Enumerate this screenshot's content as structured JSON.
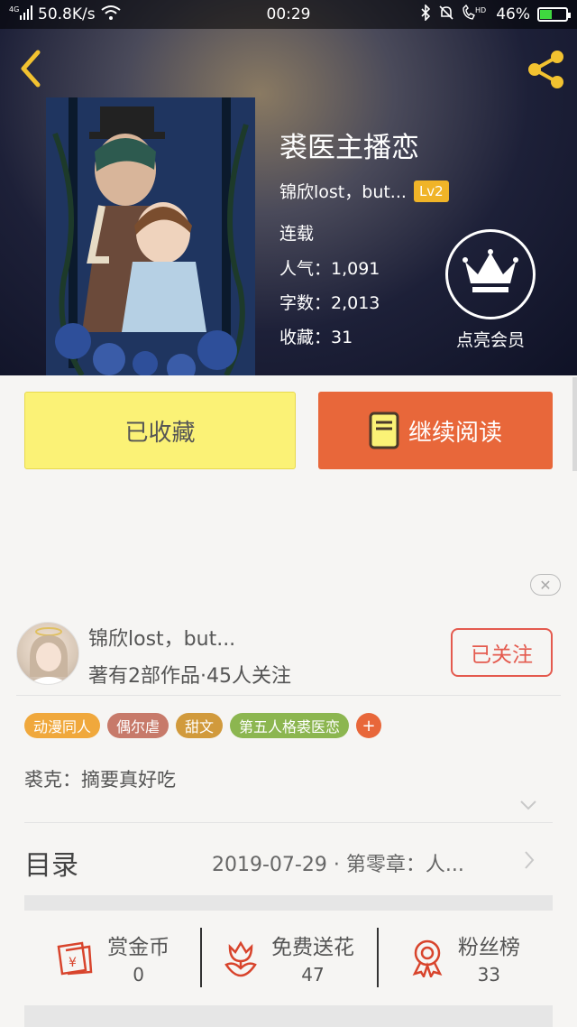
{
  "status_bar": {
    "network": "4G",
    "speed": "50.8K/s",
    "time": "00:29",
    "hd": "HD",
    "battery": "46%",
    "battery_level": 0.46
  },
  "book": {
    "title": "裘医主播恋",
    "author": "锦欣lost，but...",
    "level": "Lv2",
    "status": "连载",
    "popularity": "人气：1,091",
    "word_count": "字数：2,013",
    "favorites": "收藏：31"
  },
  "vip": {
    "label": "点亮会员"
  },
  "actions": {
    "collected_label": "已收藏",
    "continue_label": "继续阅读"
  },
  "author_card": {
    "name": "锦欣lost，but...",
    "stats": "著有2部作品·45人关注",
    "follow_label": "已关注"
  },
  "tags": [
    {
      "label": "动漫同人",
      "color": "#f0a83c"
    },
    {
      "label": "偶尔虐",
      "color": "#c77a6a"
    },
    {
      "label": "甜文",
      "color": "#d19a3c"
    },
    {
      "label": "第五人格裘医恋",
      "color": "#8cb650"
    }
  ],
  "tag_add": "+",
  "summary": "裘克：摘要真好吃",
  "toc": {
    "label": "目录",
    "latest": "2019-07-29 · 第零章：人..."
  },
  "stats": [
    {
      "label": "赏金币",
      "value": "0",
      "icon": "bounty-coin-icon"
    },
    {
      "label": "免费送花",
      "value": "47",
      "icon": "flower-icon"
    },
    {
      "label": "粉丝榜",
      "value": "33",
      "icon": "ribbon-badge-icon"
    }
  ],
  "colors": {
    "accent": "#e8673a",
    "collected_bg": "#fbf276",
    "follow": "#e45a4e",
    "badge": "#f0b428"
  }
}
